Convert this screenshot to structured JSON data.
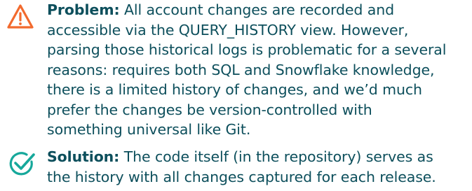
{
  "problem": {
    "icon": "warning-triangle-icon",
    "icon_color": "#f26a2e",
    "label": "Problem:",
    "lines": [
      " All account changes are recorded and",
      "accessible via the QUERY_HISTORY view. However,",
      "parsing those historical logs is problematic for a several",
      "reasons: requires both SQL and Snowflake knowledge,",
      "there is a limited history of changes, and we’d much",
      "prefer the changes be version-controlled with",
      "something universal like Git."
    ]
  },
  "solution": {
    "icon": "check-circle-icon",
    "icon_color": "#16a89b",
    "label": "Solution:",
    "lines": [
      " The code itself (in the repository) serves as",
      "the history with all changes captured for each release."
    ]
  },
  "text_color": "#0d4f5c"
}
